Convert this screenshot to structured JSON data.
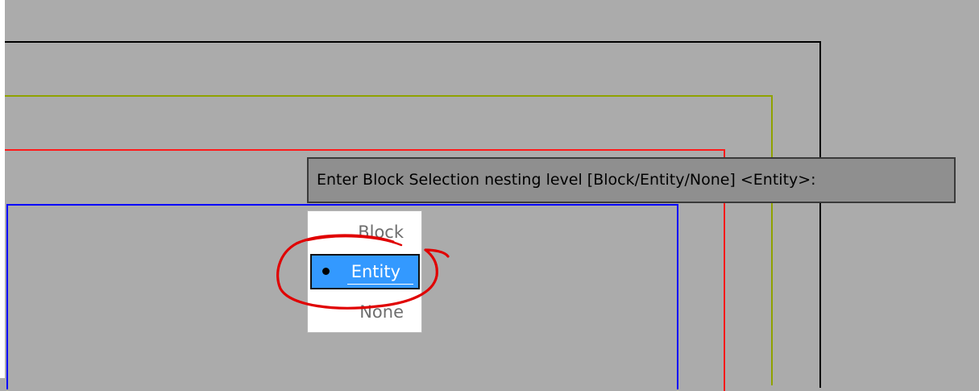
{
  "prompt": {
    "text": "Enter Block Selection nesting level [Block/Entity/None] <Entity>:"
  },
  "menu": {
    "options": [
      "Block",
      "Entity",
      "None"
    ],
    "selected": "Entity"
  },
  "colors": {
    "canvas_background": "#ababab",
    "frame_outer": "#000000",
    "frame_second": "#8fa200",
    "frame_third": "#ff1a1a",
    "frame_inner": "#0000ff",
    "selection_highlight": "#3399ff",
    "annotation_circle": "#e00000"
  }
}
